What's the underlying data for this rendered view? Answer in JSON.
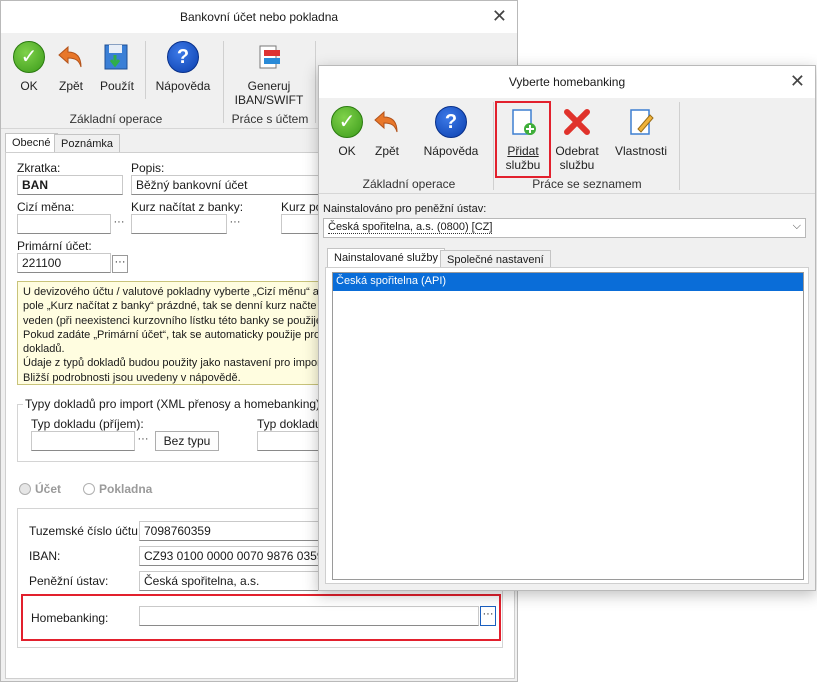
{
  "main": {
    "title": "Bankovní účet nebo pokladna",
    "toolbar": {
      "ok": "OK",
      "back": "Zpět",
      "apply": "Použít",
      "help": "Nápověda",
      "generate_line1": "Generuj",
      "generate_line2": "IBAN/SWIFT",
      "group_basic": "Základní operace",
      "group_account": "Práce s účtem"
    },
    "tabs": [
      "Obecné",
      "Poznámka"
    ],
    "fields": {
      "shortcut_label": "Zkratka:",
      "shortcut_value": "BAN",
      "description_label": "Popis:",
      "description_value": "Běžný bankovní účet",
      "currency_label": "Cizí měna:",
      "rate_label": "Kurz načítat z banky:",
      "rate2_label": "Kurz pod",
      "primary_label": "Primární účet:",
      "primary_value": "221100"
    },
    "info_lines": [
      "U devizového účtu / valutové pokladny vyberte „Cizí měnu“ a",
      "pole „Kurz načítat z banky“ prázdné, tak se denní kurz načte z",
      "veden (při neexistenci kurzovního lístku této banky se použije",
      "Pokud zadáte „Primární účet“, tak se automaticky použije pro z",
      "dokladů.",
      "Údaje z typů dokladů budou použity jako nastavení pro import",
      "Bližší podrobnosti jsou uvedeny v nápovědě."
    ],
    "import_group": {
      "legend": "Typy dokladů pro import (XML přenosy a homebanking)",
      "income_label": "Typ dokladu (příjem):",
      "no_type_button": "Bez typu",
      "expense_label": "Typ dokladu ("
    },
    "radios": {
      "account": "Účet",
      "cash": "Pokladna"
    },
    "bank": {
      "domestic_label": "Tuzemské číslo účtu:",
      "domestic_value": "7098760359",
      "iban_label": "IBAN:",
      "iban_value": "CZ93 0100 0000 0070 9876 0359",
      "institution_label": "Peněžní ústav:",
      "institution_value": "Česká spořitelna, a.s.",
      "homebanking_label": "Homebanking:",
      "homebanking_value": ""
    }
  },
  "dialog": {
    "title": "Vyberte homebanking",
    "toolbar": {
      "ok": "OK",
      "back": "Zpět",
      "help": "Nápověda",
      "add_line1": "Přidat",
      "add_line2": "službu",
      "remove_line1": "Odebrat",
      "remove_line2": "službu",
      "properties": "Vlastnosti",
      "group_basic": "Základní operace",
      "group_list": "Práce se seznamem"
    },
    "installed_for_label": "Nainstalováno pro peněžní ústav:",
    "installed_for_value": "Česká spořitelna, a.s. (0800) [CZ]",
    "tabs": [
      "Nainstalované služby",
      "Společné nastavení"
    ],
    "services": [
      "Česká spořitelna (API)"
    ]
  },
  "colors": {
    "highlight": "#e2202d",
    "selection": "#0a6dd8",
    "info_bg": "#fffde0"
  }
}
